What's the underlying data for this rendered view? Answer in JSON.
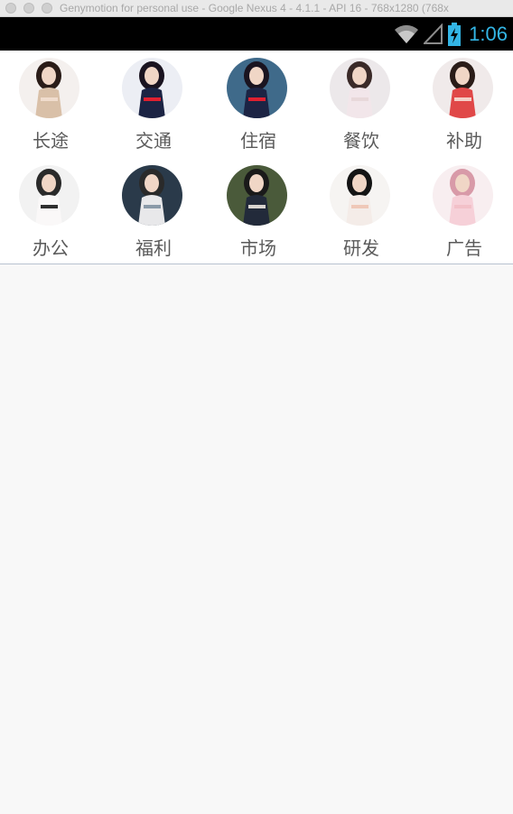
{
  "window": {
    "title": "Genymotion for personal use - Google Nexus 4 - 4.1.1 - API 16 - 768x1280 (768x"
  },
  "status_bar": {
    "time": "1:06",
    "icons": [
      "wifi-icon",
      "signal-icon",
      "battery-charging-icon"
    ],
    "time_color": "#33b5e5"
  },
  "grid": {
    "items": [
      {
        "label": "长途",
        "bg": "#f4f0ee",
        "dress": "#d9c0a8",
        "hair": "#2a1c18",
        "accent": "#f0dccd"
      },
      {
        "label": "交通",
        "bg": "#eceef4",
        "dress": "#1c2444",
        "hair": "#1a1420",
        "accent": "#e02030"
      },
      {
        "label": "住宿",
        "bg": "#3f6a8a",
        "dress": "#1c2444",
        "hair": "#1a1420",
        "accent": "#e02030"
      },
      {
        "label": "餐饮",
        "bg": "#ece8ea",
        "dress": "#f2e6ea",
        "hair": "#3a2a28",
        "accent": "#e8d8da"
      },
      {
        "label": "补助",
        "bg": "#f0eaea",
        "dress": "#e04848",
        "hair": "#2a1c18",
        "accent": "#f4d0c8"
      },
      {
        "label": "办公",
        "bg": "#f2f2f2",
        "dress": "#faf8f8",
        "hair": "#2a2a2a",
        "accent": "#303030"
      },
      {
        "label": "福利",
        "bg": "#2a3a4a",
        "dress": "#e8e8ea",
        "hair": "#2a2a2a",
        "accent": "#8a9aa8"
      },
      {
        "label": "市场",
        "bg": "#4a5a3a",
        "dress": "#222a3a",
        "hair": "#1a1a1a",
        "accent": "#d8d4d0"
      },
      {
        "label": "研发",
        "bg": "#f6f4f2",
        "dress": "#f4ece8",
        "hair": "#141414",
        "accent": "#efc8b8"
      },
      {
        "label": "广告",
        "bg": "#f8eef0",
        "dress": "#f6d0d8",
        "hair": "#d89aa8",
        "accent": "#f2c0c8"
      }
    ]
  }
}
